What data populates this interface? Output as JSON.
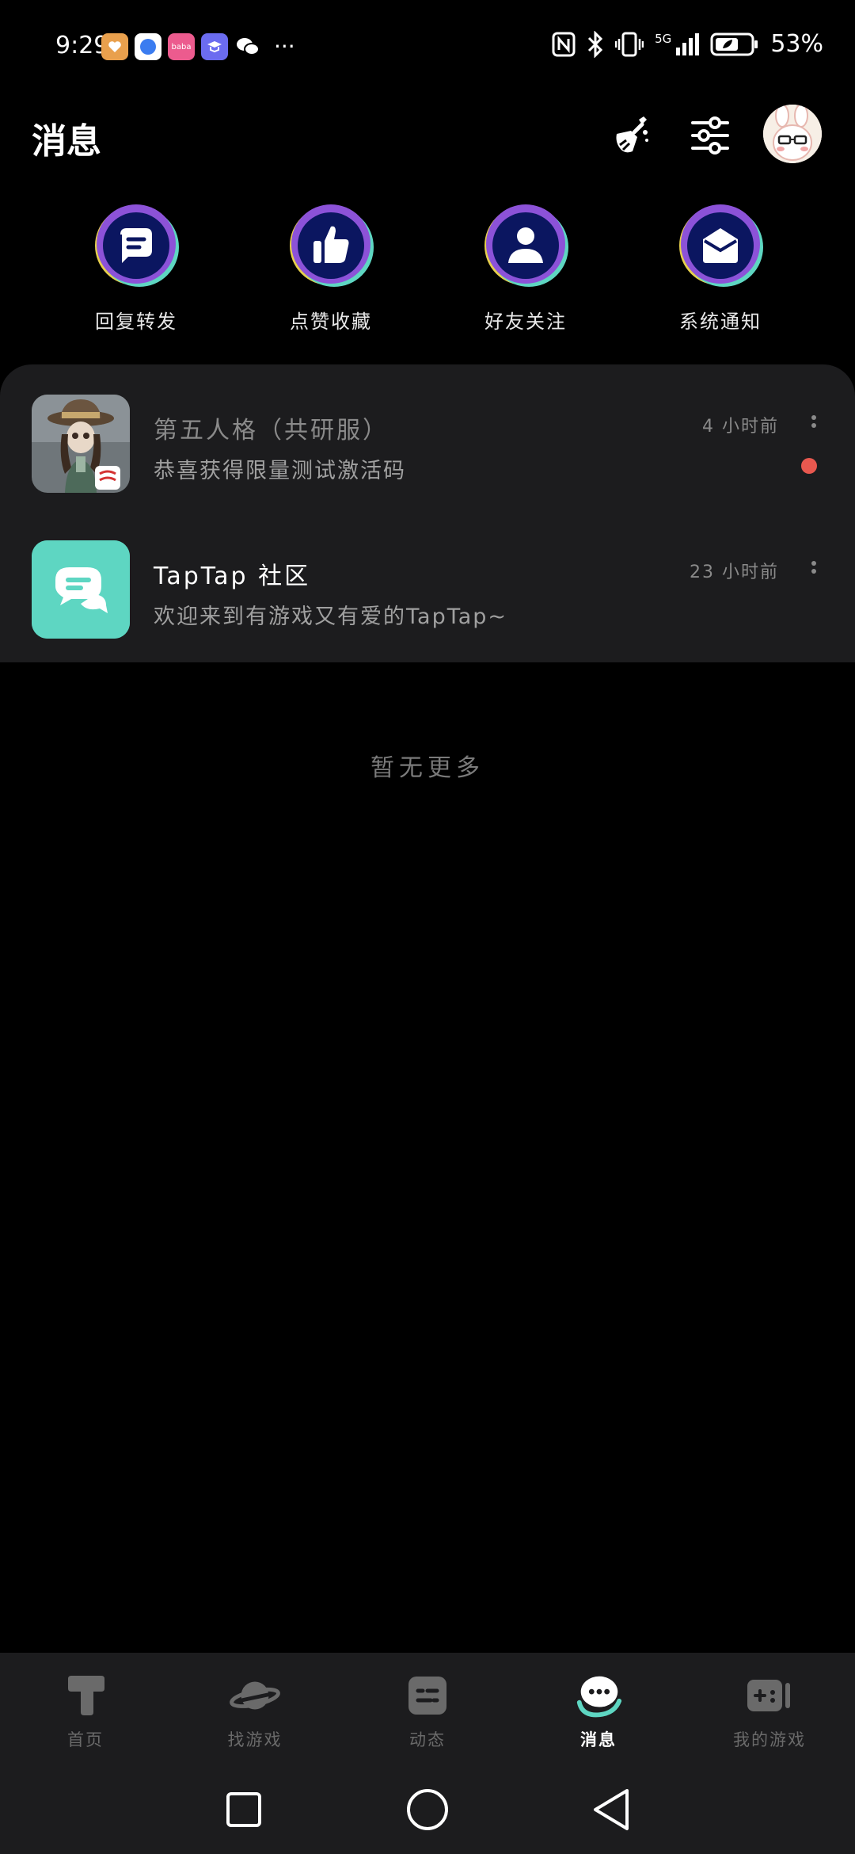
{
  "status_bar": {
    "time": "9:29",
    "network": "5G",
    "battery": "53%",
    "app_icons": [
      "health-app-icon",
      "browser-app-icon",
      "baba-app-icon",
      "education-app-icon",
      "wechat-icon"
    ],
    "baba_label": "baba",
    "more": "···"
  },
  "header": {
    "title": "消息",
    "clean_icon": "broom-icon",
    "filter_icon": "sliders-icon"
  },
  "categories": [
    {
      "label": "回复转发",
      "icon": "chat-bubble-icon"
    },
    {
      "label": "点赞收藏",
      "icon": "thumbs-up-icon"
    },
    {
      "label": "好友关注",
      "icon": "person-icon"
    },
    {
      "label": "系统通知",
      "icon": "envelope-icon"
    }
  ],
  "messages": [
    {
      "name": "第五人格（共研服）",
      "preview": "恭喜获得限量测试激活码",
      "time": "4 小时前",
      "unread": true
    },
    {
      "name": "TapTap 社区",
      "preview": "欢迎来到有游戏又有爱的TapTap~",
      "time": "23 小时前",
      "unread": false
    }
  ],
  "empty_text": "暂无更多",
  "tabs": [
    {
      "label": "首页",
      "icon": "home-t-icon"
    },
    {
      "label": "找游戏",
      "icon": "planet-icon"
    },
    {
      "label": "动态",
      "icon": "feed-icon"
    },
    {
      "label": "消息",
      "icon": "message-icon",
      "active": true
    },
    {
      "label": "我的游戏",
      "icon": "gamepad-icon"
    }
  ],
  "colors": {
    "accent": "#5ED6C2",
    "background": "#000000",
    "panel": "#1C1C1E",
    "unread": "#E8584F",
    "category_ring_purple": "#8C52D8",
    "category_ring_yellow": "#E7D04C",
    "category_core": "#0B1660"
  }
}
